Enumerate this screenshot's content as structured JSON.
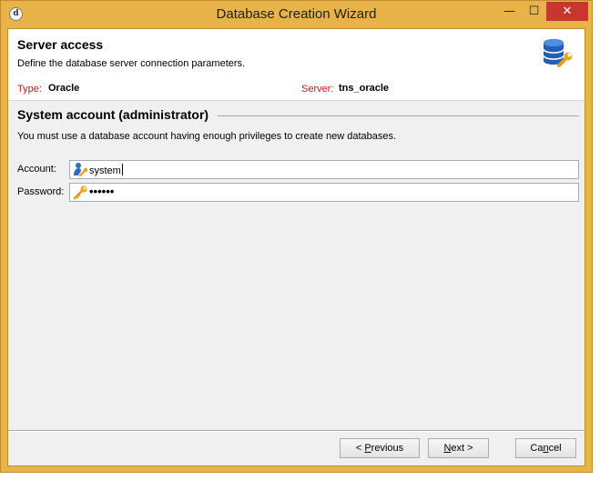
{
  "window": {
    "title": "Database Creation Wizard",
    "app_icon_glyph": "d",
    "minimize_glyph": "—",
    "maximize_glyph": "☐",
    "close_glyph": "✕"
  },
  "header": {
    "title": "Server access",
    "description": "Define the database server connection parameters.",
    "icon": "database-wrench-icon"
  },
  "info": {
    "type_label": "Type:",
    "type_value": "Oracle",
    "server_label": "Server:",
    "server_value": "tns_oracle"
  },
  "section": {
    "title": "System account (administrator)",
    "description": "You must use a database account having enough privileges to create new databases."
  },
  "form": {
    "account_label": "Account:",
    "account_value": "system",
    "account_icon": "user-key-icon",
    "password_label": "Password:",
    "password_value": "••••••",
    "password_icon": "key-icon"
  },
  "buttons": {
    "previous_prefix": "< ",
    "previous_key": "P",
    "previous_rest": "revious",
    "next_key": "N",
    "next_rest": "ext >",
    "cancel_prefix": "Ca",
    "cancel_key": "n",
    "cancel_rest": "cel"
  },
  "colors": {
    "window_frame": "#e8b44a",
    "close_button": "#c7372f",
    "label_red": "#c0191b"
  }
}
